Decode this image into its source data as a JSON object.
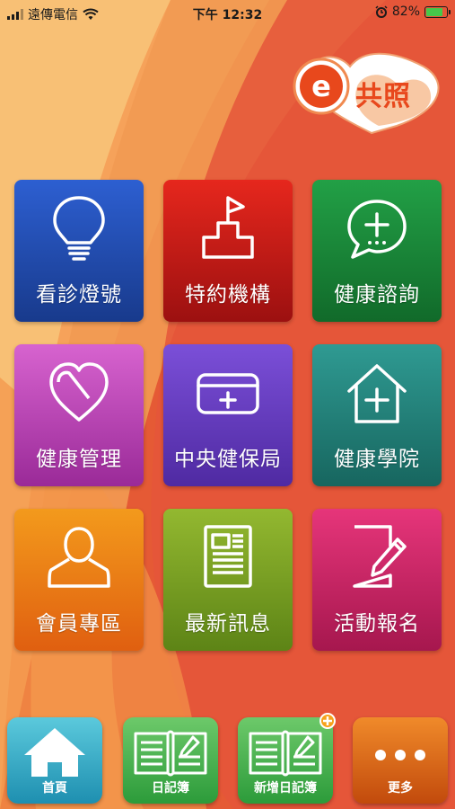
{
  "status_bar": {
    "carrier": "遠傳電信",
    "time": "下午 12:32",
    "battery": "82%",
    "battery_level": 0.82
  },
  "logo": {
    "text": "共照",
    "letter": "e"
  },
  "tiles": [
    {
      "label": "看診燈號",
      "icon": "lightbulb-icon",
      "color_top": "#2d5fd1",
      "color_bottom": "#183a8c"
    },
    {
      "label": "特約機構",
      "icon": "building-flag-icon",
      "color_top": "#e6271d",
      "color_bottom": "#9c1010"
    },
    {
      "label": "健康諮詢",
      "icon": "chat-plus-icon",
      "color_top": "#22a046",
      "color_bottom": "#116a2a"
    },
    {
      "label": "健康管理",
      "icon": "heart-icon",
      "color_top": "#d763cf",
      "color_bottom": "#9a2a98"
    },
    {
      "label": "中央健保局",
      "icon": "health-card-icon",
      "color_top": "#7b4fd8",
      "color_bottom": "#4f2aa2"
    },
    {
      "label": "健康學院",
      "icon": "house-plus-icon",
      "color_top": "#2f9a92",
      "color_bottom": "#17665f"
    },
    {
      "label": "會員專區",
      "icon": "member-icon",
      "color_top": "#f39a1c",
      "color_bottom": "#e05f10"
    },
    {
      "label": "最新訊息",
      "icon": "news-icon",
      "color_top": "#93b830",
      "color_bottom": "#5d8416"
    },
    {
      "label": "活動報名",
      "icon": "signup-edit-icon",
      "color_top": "#e6357a",
      "color_bottom": "#a6174e"
    }
  ],
  "bottom_nav": [
    {
      "label": "首頁",
      "icon": "home-icon",
      "color_top": "#5bc9dc",
      "color_bottom": "#1e8fb0"
    },
    {
      "label": "日記簿",
      "icon": "diary-icon",
      "color_top": "#6dc96a",
      "color_bottom": "#2c9b3a"
    },
    {
      "label": "新增日記簿",
      "icon": "add-diary-icon",
      "color_top": "#6dc96a",
      "color_bottom": "#2c9b3a"
    },
    {
      "label": "更多",
      "icon": "more-dots-icon",
      "color_top": "#f08a2a",
      "color_bottom": "#c24a0c"
    }
  ]
}
